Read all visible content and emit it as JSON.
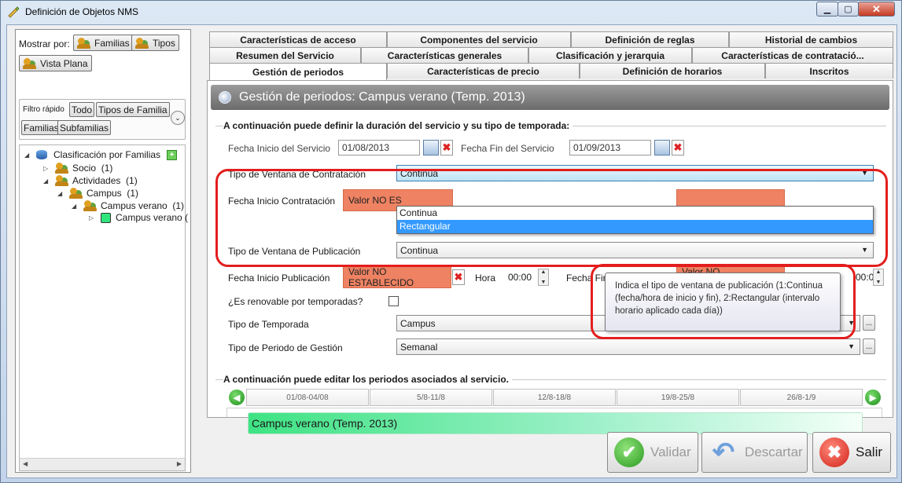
{
  "window": {
    "title": "Definición de Objetos NMS",
    "title_suffix": ""
  },
  "left": {
    "show_by_label": "Mostrar por:",
    "btn_familias": "Familias",
    "btn_tipos": "Tipos",
    "btn_vista_plana": "Vista Plana",
    "quick_filter_label": "Filtro rápido",
    "filter_todo": "Todo",
    "filter_tipos_familia": "Tipos de Familia",
    "filter_familias": "Familias",
    "filter_subfamilias": "Subfamilias",
    "tree": [
      {
        "label": "Clasificación por Familias"
      },
      {
        "label": "Socio",
        "count": "(1)"
      },
      {
        "label": "Actividades",
        "count": "(1)"
      },
      {
        "label": "Campus",
        "count": "(1)"
      },
      {
        "label": "Campus verano",
        "count": "(1)"
      },
      {
        "label": "Campus verano ("
      }
    ]
  },
  "tabs": {
    "row1": [
      "Características de acceso",
      "Componentes del servicio",
      "Definición de reglas",
      "Historial de cambios"
    ],
    "row2": [
      "Resumen del Servicio",
      "Características generales",
      "Clasificación y jerarquia",
      "Características de contratació..."
    ],
    "row3": [
      "Gestión de periodos",
      "Características de precio",
      "Definición de horarios",
      "Inscritos"
    ]
  },
  "header": {
    "title": "Gestión de periodos: Campus verano (Temp. 2013)"
  },
  "form": {
    "section1": "A continuación puede definir la duración del servicio y su tipo de temporada:",
    "fecha_inicio_servicio_label": "Fecha Inicio del Servicio",
    "fecha_inicio_servicio_value": "01/08/2013",
    "fecha_fin_servicio_label": "Fecha Fin del Servicio",
    "fecha_fin_servicio_value": "01/09/2013",
    "tipo_ventana_contratacion_label": "Tipo de Ventana de Contratación",
    "tipo_ventana_contratacion_value": "Continua",
    "fecha_inicio_contratacion_label": "Fecha Inicio Contratación",
    "fecha_inicio_contratacion_value": "Valor NO ES",
    "tipo_ventana_publicacion_label": "Tipo de Ventana de Publicación",
    "tipo_ventana_publicacion_value": "Continua",
    "fecha_inicio_publicacion_label": "Fecha Inicio Publicación",
    "fecha_inicio_publicacion_value": "Valor NO ESTABLECIDO",
    "hora_label": "Hora",
    "hora_value": "00:00",
    "fecha_fin_publicacion_label": "Fecha Fin Publicación",
    "fecha_fin_publicacion_value": "Valor NO ESTABLECIDO",
    "hora2_value": "00:00",
    "renovable_label": "¿Es renovable por temporadas?",
    "tipo_temporada_label": "Tipo de Temporada",
    "tipo_temporada_value": "Campus",
    "tipo_periodo_label": "Tipo de Periodo de Gestión",
    "tipo_periodo_value": "Semanal",
    "section2": "A continuación puede editar los periodos asociados al servicio."
  },
  "dropdown": {
    "options": [
      "Continua",
      "Rectangular"
    ],
    "selected": "Rectangular"
  },
  "tooltip": {
    "text": "Indica el tipo de ventana de publicación (1:Continua (fecha/hora de inicio y fin), 2:Rectangular (intervalo horario aplicado cada día))"
  },
  "timeline": {
    "weeks": [
      "01/08-04/08",
      "5/8-11/8",
      "12/8-18/8",
      "19/8-25/8",
      "26/8-1/9"
    ],
    "period_label": "Campus verano (Temp. 2013)"
  },
  "buttons": {
    "validar": "Validar",
    "descartar": "Descartar",
    "salir": "Salir"
  },
  "colors": {
    "not_set": "#ee8262",
    "highlight": "#e31e1e",
    "selected_option": "#3399ff",
    "period_bar": "#3ee383"
  }
}
